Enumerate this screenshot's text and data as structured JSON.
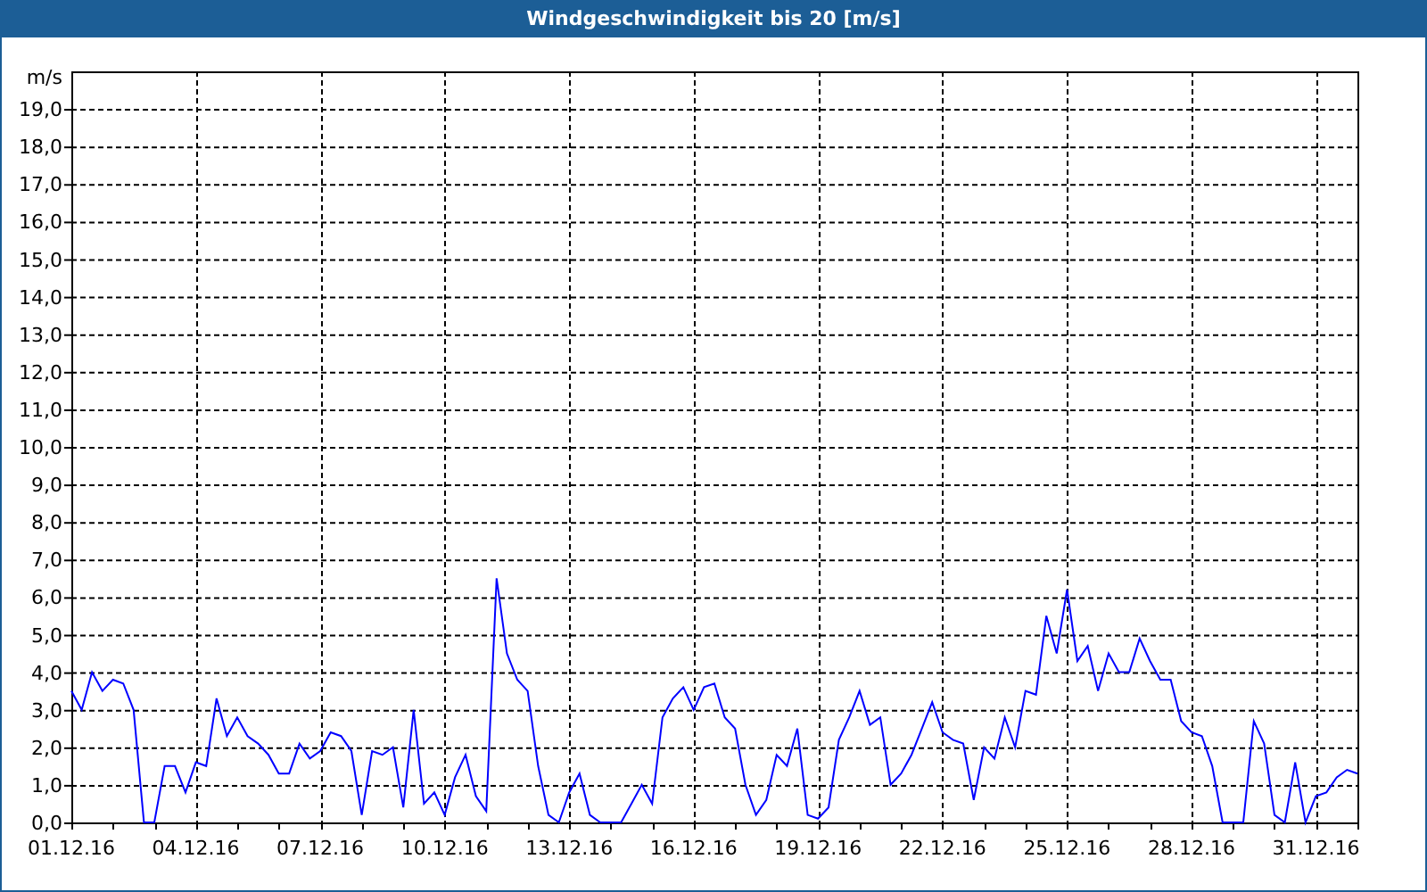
{
  "window": {
    "title": "Windgeschwindigkeit bis 20 [m/s]"
  },
  "chart": {
    "chart_data": {
      "type": "line",
      "grid": true,
      "ylabel": "m/s",
      "ylim": [
        0,
        20
      ],
      "yticks": [
        {
          "value": 0,
          "label": "0,0"
        },
        {
          "value": 1,
          "label": "1,0"
        },
        {
          "value": 2,
          "label": "2,0"
        },
        {
          "value": 3,
          "label": "3,0"
        },
        {
          "value": 4,
          "label": "4,0"
        },
        {
          "value": 5,
          "label": "5,0"
        },
        {
          "value": 6,
          "label": "6,0"
        },
        {
          "value": 7,
          "label": "7,0"
        },
        {
          "value": 8,
          "label": "8,0"
        },
        {
          "value": 9,
          "label": "9,0"
        },
        {
          "value": 10,
          "label": "10,0"
        },
        {
          "value": 11,
          "label": "11,0"
        },
        {
          "value": 12,
          "label": "12,0"
        },
        {
          "value": 13,
          "label": "13,0"
        },
        {
          "value": 14,
          "label": "14,0"
        },
        {
          "value": 15,
          "label": "15,0"
        },
        {
          "value": 16,
          "label": "16,0"
        },
        {
          "value": 17,
          "label": "17,0"
        },
        {
          "value": 18,
          "label": "18,0"
        },
        {
          "value": 19,
          "label": "19,0"
        }
      ],
      "categories": [
        "01.12.16",
        null,
        null,
        null,
        null,
        null,
        null,
        null,
        null,
        null,
        null,
        null,
        "04.12.16",
        null,
        null,
        null,
        null,
        null,
        null,
        null,
        null,
        null,
        null,
        null,
        "07.12.16",
        null,
        null,
        null,
        null,
        null,
        null,
        null,
        null,
        null,
        null,
        null,
        "10.12.16",
        null,
        null,
        null,
        null,
        null,
        null,
        null,
        null,
        null,
        null,
        null,
        "13.12.16",
        null,
        null,
        null,
        null,
        null,
        null,
        null,
        null,
        null,
        null,
        null,
        "16.12.16",
        null,
        null,
        null,
        null,
        null,
        null,
        null,
        null,
        null,
        null,
        null,
        "19.12.16",
        null,
        null,
        null,
        null,
        null,
        null,
        null,
        null,
        null,
        null,
        null,
        "22.12.16",
        null,
        null,
        null,
        null,
        null,
        null,
        null,
        null,
        null,
        null,
        null,
        "25.12.16",
        null,
        null,
        null,
        null,
        null,
        null,
        null,
        null,
        null,
        null,
        null,
        "28.12.16",
        null,
        null,
        null,
        null,
        null,
        null,
        null,
        null,
        null,
        null,
        null,
        "31.12.16",
        null,
        null,
        null,
        null
      ],
      "series": [
        {
          "color": "#0000ff",
          "values": [
            3.5,
            3.0,
            4.0,
            3.5,
            3.8,
            3.7,
            3.0,
            0,
            0,
            1.5,
            1.5,
            0.8,
            1.6,
            1.5,
            3.3,
            2.3,
            2.8,
            2.3,
            2.1,
            1.8,
            1.3,
            1.3,
            2.1,
            1.7,
            1.9,
            2.4,
            2.3,
            1.9,
            0.2,
            1.9,
            1.8,
            2.0,
            0.4,
            3.0,
            0.5,
            0.8,
            0.2,
            1.2,
            1.8,
            0.7,
            0.3,
            6.5,
            4.5,
            3.8,
            3.5,
            1.5,
            0.2,
            0,
            0.8,
            1.3,
            0.2,
            0,
            0,
            0,
            0.5,
            1.0,
            0.5,
            2.8,
            3.3,
            3.6,
            3.0,
            3.6,
            3.7,
            2.8,
            2.5,
            1.0,
            0.2,
            0.6,
            1.8,
            1.5,
            2.5,
            0.2,
            0.1,
            0.4,
            2.2,
            2.8,
            3.5,
            2.6,
            2.8,
            1.0,
            1.3,
            1.8,
            2.5,
            3.2,
            2.4,
            2.2,
            2.1,
            0.6,
            2.0,
            1.7,
            2.8,
            2.0,
            3.5,
            3.4,
            5.5,
            4.5,
            6.2,
            4.3,
            4.7,
            3.5,
            4.5,
            4.0,
            4.0,
            4.9,
            4.3,
            3.8,
            3.8,
            2.7,
            2.4,
            2.3,
            1.5,
            0,
            0,
            0,
            2.7,
            2.1,
            0.2,
            0,
            1.6,
            0,
            0.7,
            0.8,
            1.2,
            1.4,
            1.3
          ]
        }
      ]
    }
  }
}
